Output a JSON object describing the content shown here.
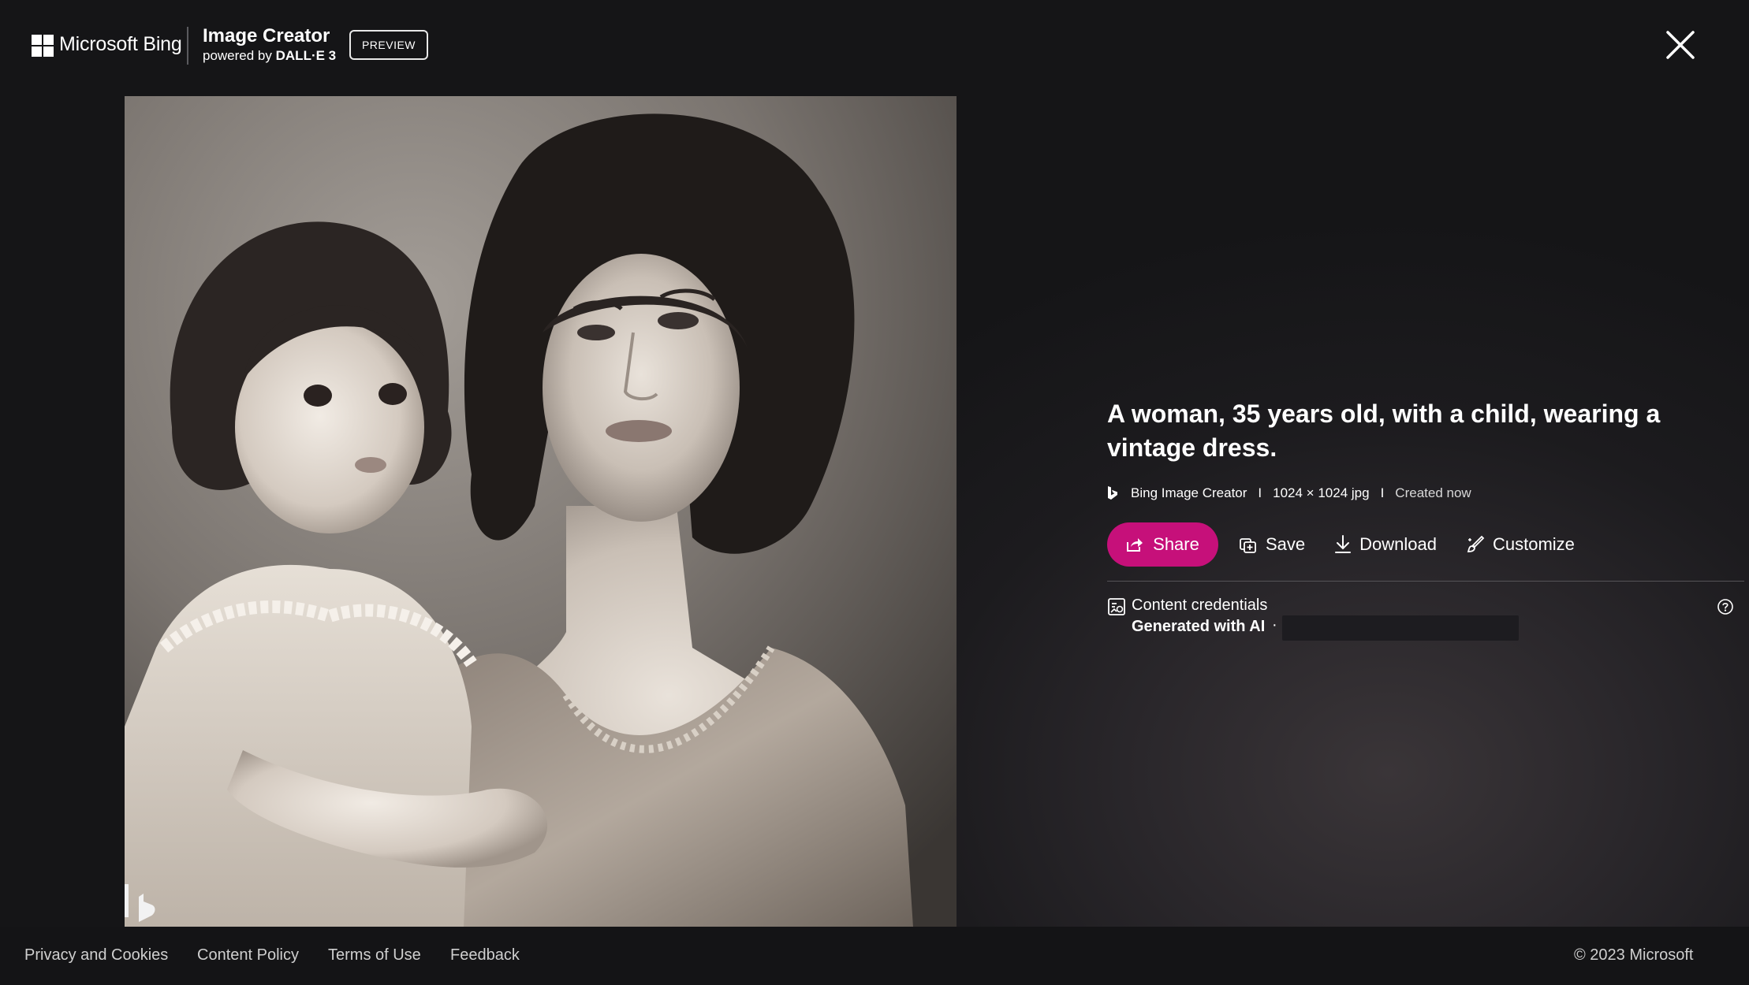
{
  "header": {
    "brand": "Microsoft Bing",
    "product_title": "Image Creator",
    "powered_by_prefix": "powered by",
    "powered_by_model": "DALL·E 3",
    "preview_badge": "PREVIEW",
    "close_icon": "close-icon"
  },
  "image": {
    "description_icon": "bing-watermark-icon"
  },
  "details": {
    "title": "A woman, 35 years old, with a child, wearing a vintage dress.",
    "meta": {
      "source": "Bing Image Creator",
      "separator": "I",
      "dimensions": "1024 × 1024 jpg",
      "created": "Created now"
    },
    "actions": {
      "share": "Share",
      "save": "Save",
      "download": "Download",
      "customize": "Customize"
    },
    "credentials": {
      "label": "Content credentials",
      "value": "Generated with AI",
      "dot": "·"
    }
  },
  "footer": {
    "links": [
      "Privacy and Cookies",
      "Content Policy",
      "Terms of Use",
      "Feedback"
    ],
    "copyright": "© 2023 Microsoft"
  },
  "colors": {
    "share_button": "#c6107a",
    "background": "#141416"
  }
}
